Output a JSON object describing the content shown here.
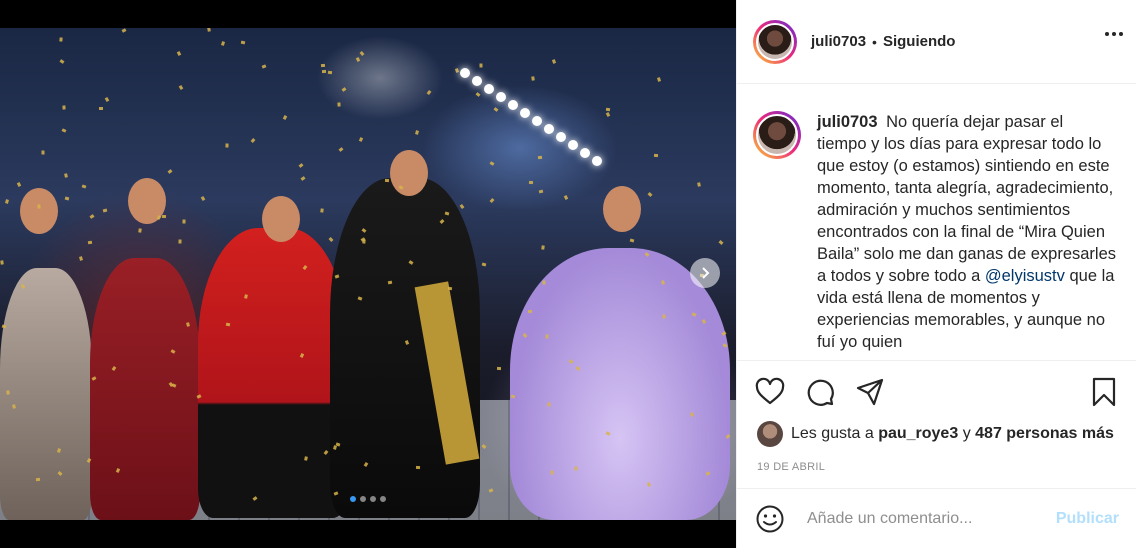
{
  "post": {
    "username": "juli0703",
    "separator": "•",
    "follow_status": "Siguiendo"
  },
  "caption": {
    "username": "juli0703",
    "text_before": "No quería dejar pasar el tiempo y los días para expresar todo lo que estoy (o estamos) sintiendo en este momento, tanta alegría, agradecimiento, admiración y muchos sentimientos encontrados con la final de “Mira Quien Baila” solo me dan ganas de expresarles a todos y sobre todo a",
    "mention": "@elyisustv",
    "text_after": "que la vida está llena de momentos y experiencias memorables, y aunque no fuí yo quien"
  },
  "actions": {
    "like_icon": "heart-icon",
    "comment_icon": "comment-icon",
    "share_icon": "share-icon",
    "save_icon": "bookmark-icon"
  },
  "likes": {
    "prefix": "Les gusta a",
    "liker": "pau_roye3",
    "connector": "y",
    "others": "487 personas más"
  },
  "date": "19 DE ABRIL",
  "comment_box": {
    "placeholder": "Añade un comentario...",
    "publish_label": "Publicar"
  },
  "carousel": {
    "slide_count": 4,
    "active_index": 0
  },
  "colors": {
    "link": "#00376b",
    "publish_disabled": "#b2dffc",
    "active_dot": "#3897f0"
  }
}
